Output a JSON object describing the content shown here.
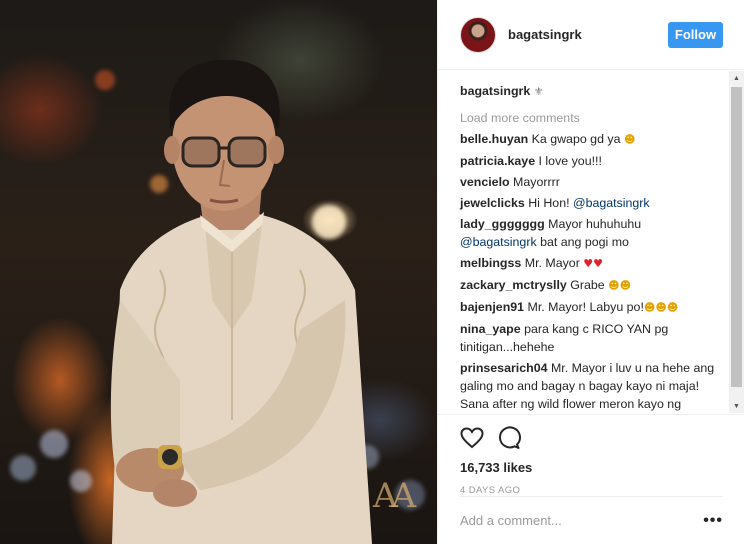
{
  "post": {
    "username": "bagatsingrk",
    "follow_label": "Follow",
    "caption_username": "bagatsingrk",
    "caption_text": "⚜",
    "load_more": "Load more comments",
    "likes": "16,733 likes",
    "timestamp": "4 DAYS AGO",
    "comment_placeholder": "Add a comment...",
    "more_label": "•••",
    "watermark": "AA"
  },
  "comments": [
    {
      "user": "belle.huyan",
      "text": "Ka gwapo gd ya ",
      "emoji": "☻"
    },
    {
      "user": "patricia.kaye",
      "text": "I love you!!!"
    },
    {
      "user": "vencielo",
      "text": "Mayorrrr"
    },
    {
      "user": "jewelclicks",
      "text": "Hi Hon! ",
      "mention": "@bagatsingrk"
    },
    {
      "user": "lady_ggggggg",
      "text": "Mayor huhuhuhu ",
      "mention": "@bagatsingrk",
      "text2": " bat ang pogi mo"
    },
    {
      "user": "melbingss",
      "text": "Mr. Mayor ",
      "emoji": "♥♥",
      "emoji_type": "heart"
    },
    {
      "user": "zackary_mctryslly",
      "text": "Grabe ",
      "emoji": "☻☻"
    },
    {
      "user": "bajenjen91",
      "text": "Mr. Mayor! Labyu po!",
      "emoji": "☻☻☻"
    },
    {
      "user": "nina_yape",
      "text": "para kang c RICO YAN pg tinitigan...hehehe"
    },
    {
      "user": "prinsesarich04",
      "text": "Mr. Mayor i luv u na hehe ang galing mo and bagay n bagay kayo ni maja! Sana after ng wild flower meron kayo ng teleserye na kayo ang magkasama"
    }
  ]
}
